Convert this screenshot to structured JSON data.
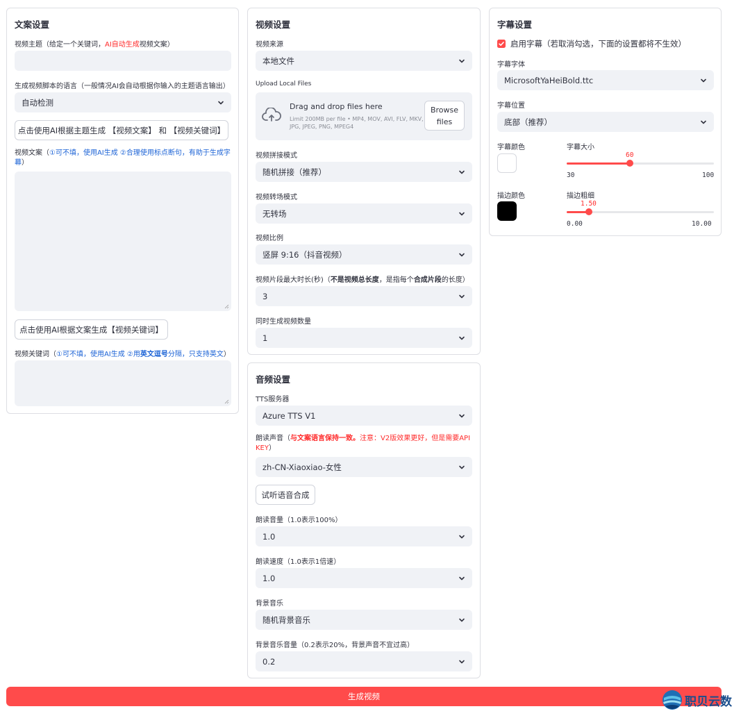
{
  "col1": {
    "title": "文案设置",
    "subject_label_a": "视频主题（给定一个关键词，",
    "subject_label_red": "AI自动生成",
    "subject_label_b": "视频文案）",
    "subject_value": "",
    "lang_label": "生成视频脚本的语言（一般情况AI会自动根据你输入的主题语言输出）",
    "lang_value": "自动检测",
    "gen_script_button": "点击使用AI根据主题生成 【视频文案】 和 【视频关键词】",
    "script_label_a": "视频文案（",
    "script_label_blue_1": "①可不填，使用AI生成 ②合理使用标点断句，有助于生成字",
    "script_label_blue_2": "幕",
    "script_label_b": "）",
    "script_value": "",
    "gen_keywords_button": "点击使用AI根据文案生成【视频关键词】",
    "kw_label_a": "视频关键词（",
    "kw_label_blue_1": "①可不填，使用AI生成 ②用",
    "kw_label_blue_bold": "英文逗号",
    "kw_label_blue_2": "分隔，只支持英文",
    "kw_label_b": "）",
    "kw_value": ""
  },
  "col2": {
    "title": "视频设置",
    "source_label": "视频来源",
    "source_value": "本地文件",
    "upload_label": "Upload Local Files",
    "upload_drag": "Drag and drop files here",
    "upload_limit_1": "Limit 200MB per file • MP4, MOV, AVI, FLV, MKV,",
    "upload_limit_2": "JPG, JPEG, PNG, MPEG4",
    "browse_1": "Browse",
    "browse_2": "files",
    "concat_label": "视频拼接模式",
    "concat_value": "随机拼接（推荐）",
    "transition_label": "视频转场模式",
    "transition_value": "无转场",
    "aspect_label": "视频比例",
    "aspect_value": "竖屏 9:16（抖音视频）",
    "clip_label_a": "视频片段最大时长(秒)（",
    "clip_label_bold": "不是视频总长度",
    "clip_label_b": "，是指每个",
    "clip_label_bold2": "合成片段",
    "clip_label_c": "的长度）",
    "clip_value": "3",
    "count_label": "同时生成视频数量",
    "count_value": "1"
  },
  "col3": {
    "title": "音频设置",
    "tts_label": "TTS服务器",
    "tts_value": "Azure TTS V1",
    "voice_label_a": "朗读声音（",
    "voice_label_red_bold": "与文案语言保持一致。",
    "voice_label_red_1": "注意：V2版效果更好，但是需要API",
    "voice_label_red_2": "KEY",
    "voice_label_b": "）",
    "voice_value": "zh-CN-Xiaoxiao-女性",
    "try_button": "试听语音合成",
    "volume_label": "朗读音量（1.0表示100%）",
    "volume_value": "1.0",
    "rate_label": "朗读速度（1.0表示1倍速）",
    "rate_value": "1.0",
    "bgm_label": "背景音乐",
    "bgm_value": "随机背景音乐",
    "bgm_vol_label": "背景音乐音量（0.2表示20%，背景声音不宜过高）",
    "bgm_vol_value": "0.2"
  },
  "col4": {
    "title": "字幕设置",
    "enable_label": "启用字幕（若取消勾选，下面的设置都将不生效）",
    "enable_checked": true,
    "font_label": "字幕字体",
    "font_value": "MicrosoftYaHeiBold.ttc",
    "position_label": "字幕位置",
    "position_value": "底部（推荐）",
    "color_label": "字幕颜色",
    "color_value": "#ffffff",
    "size_label": "字幕大小",
    "size_value": "60",
    "size_min": "30",
    "size_max": "100",
    "stroke_color_label": "描边颜色",
    "stroke_color_value": "#000000",
    "stroke_width_label": "描边粗细",
    "stroke_width_value": "1.50",
    "stroke_min": "0.00",
    "stroke_max": "10.00"
  },
  "generate_button": "生成视频",
  "watermark_text": "职贝云数",
  "colors": {
    "accent": "#ff4b4b",
    "input_bg": "#f0f2f6",
    "blue_text": "#1c63d6",
    "red_text": "#ff2b2b"
  },
  "icons": {
    "dropdown": "chevron-down-icon",
    "upload": "cloud-upload-icon",
    "checkbox": "checkbox-checked-icon"
  }
}
